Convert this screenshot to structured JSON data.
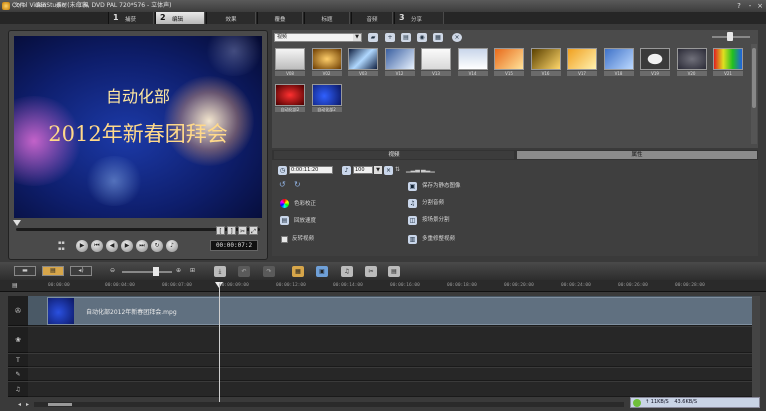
{
  "window": {
    "title": "Corel VideoStudio (未命名, DVD PAL 720*576 - 立体声)",
    "help": "?",
    "minimize": "-",
    "close": "×"
  },
  "menu": [
    "文件",
    "编辑",
    "素材",
    "工具"
  ],
  "steps": [
    {
      "num": "1",
      "label": "捕获",
      "active": false
    },
    {
      "num": "2",
      "label": "编辑",
      "active": true
    },
    {
      "label": "效果"
    },
    {
      "label": "覆叠"
    },
    {
      "label": "标题"
    },
    {
      "label": "音频"
    },
    {
      "num": "3",
      "label": "分享",
      "active": false
    }
  ],
  "preview": {
    "line1": "自动化部",
    "line2": "2012年新春团拜会",
    "timecode": "00:00:07:2",
    "trim_in": "[",
    "trim_out": "]"
  },
  "library": {
    "category": "视频",
    "row1": [
      "V08",
      "V02",
      "V03",
      "V12",
      "V13",
      "V14",
      "V15",
      "V16",
      "V17",
      "V18",
      "V19",
      "V20",
      "V21"
    ],
    "row2": [
      "自动化部2",
      "自动化部2"
    ]
  },
  "options": {
    "tabs": [
      "视频",
      "属性"
    ],
    "duration": "0:00:11:20",
    "volume": "100",
    "left_items": [
      "色彩校正",
      "回放速度",
      "反转视频"
    ],
    "right_items": [
      "保存为静态图像",
      "分割音频",
      "按场景分割",
      "多重修整视频"
    ]
  },
  "ruler": [
    "00:00:00",
    "00:00:04:00",
    "00:00:07:00",
    "00:00:09:00",
    "00:00:12:00",
    "00:00:14:00",
    "00:00:16:00",
    "00:00:18:00",
    "00:00:20:00",
    "00:00:24:00",
    "00:00:26:00",
    "00:00:28:00"
  ],
  "timeline": {
    "clip_name": "自动化部2012年新春团拜会.mpg"
  },
  "status": {
    "up": "↑ 11KB/S",
    "down": "43.6KB/S"
  },
  "colors": {
    "accent": "#d7a64a",
    "track": "#607080"
  }
}
